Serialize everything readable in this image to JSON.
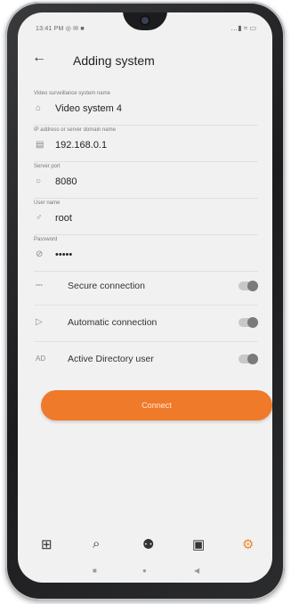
{
  "status": {
    "time": "13:41 PM",
    "notif_icons": "◎ ✉ ■",
    "right_icons": "…▮ ≈ ▭"
  },
  "appbar": {
    "back_glyph": "←",
    "title": "Adding system"
  },
  "form": {
    "fields": [
      {
        "label": "Video surveillance system name",
        "value": "Video system 4",
        "icon": "home-icon",
        "glyph": "⌂"
      },
      {
        "label": "IP address or server domain name",
        "value": "192.168.0.1",
        "icon": "server-icon",
        "glyph": "▤"
      },
      {
        "label": "Server port",
        "value": "8080",
        "icon": "shield-icon",
        "glyph": "○"
      },
      {
        "label": "User name",
        "value": "root",
        "icon": "user-icon",
        "glyph": "♂"
      },
      {
        "label": "Password",
        "value": "•••••",
        "icon": "key-icon",
        "glyph": "⊘"
      }
    ]
  },
  "toggles": [
    {
      "label": "Secure connection",
      "icon": "lock-icon",
      "glyph": "⎓",
      "on": false
    },
    {
      "label": "Automatic connection",
      "icon": "play-icon",
      "glyph": "▷",
      "on": false
    },
    {
      "label": "Active Directory user",
      "icon": "ad-icon",
      "glyph": "AD",
      "on": false
    }
  ],
  "connect_label": "Connect",
  "bottom_nav": [
    {
      "name": "nav-grid-icon",
      "glyph": "⊞"
    },
    {
      "name": "nav-search-icon",
      "glyph": "⌕"
    },
    {
      "name": "nav-robot-icon",
      "glyph": "⚉"
    },
    {
      "name": "nav-document-icon",
      "glyph": "▣"
    },
    {
      "name": "nav-settings-icon",
      "glyph": "⚙"
    }
  ],
  "system_nav": {
    "recents": "■",
    "home": "●",
    "back": "◀"
  },
  "colors": {
    "accent": "#ef7a2a",
    "background": "#f1f1f1"
  }
}
